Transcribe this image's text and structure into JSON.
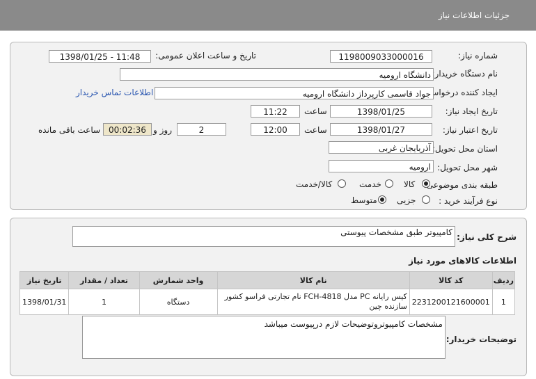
{
  "header": {
    "title": "جزئیات اطلاعات نیاز"
  },
  "form": {
    "need_number_label": "شماره نیاز:",
    "need_number": "1198009033000016",
    "announce_label": "تاریخ و ساعت اعلان عمومی:",
    "announce_value": "1398/01/25 - 11:48",
    "buyer_org_label": "نام دستگاه خریدار:",
    "buyer_org": "دانشگاه ارومیه",
    "creator_label": "ایجاد کننده درخواست:",
    "creator": "جواد قاسمی کارپرداز دانشگاه ارومیه",
    "contact_link": "اطلاعات تماس خریدار",
    "created_date_label": "تاریخ ایجاد نیاز:",
    "created_date": "1398/01/25",
    "time_label": "ساعت",
    "created_time": "11:22",
    "validity_label": "تاریخ اعتبار نیاز:",
    "validity_date": "1398/01/27",
    "validity_time": "12:00",
    "days_value": "2",
    "days_label": "روز و",
    "remaining_time": "00:02:36",
    "remaining_label": "ساعت باقی مانده",
    "province_label": "استان محل تحویل:",
    "province": "آذربایجان غربی",
    "city_label": "شهر محل تحویل:",
    "city": "ارومیه",
    "category_label": "طبقه بندی موضوعی:",
    "category_options": [
      "کالا",
      "خدمت",
      "کالا/خدمت"
    ],
    "category_selected": 0,
    "process_label": "نوع فرآیند خرید :",
    "process_options": [
      "جزیی",
      "متوسط"
    ],
    "process_selected": 1
  },
  "summary": {
    "label": "شرح کلی نیاز:",
    "value": "کامپیوتر طبق مشخصات پیوستی"
  },
  "items": {
    "title": "اطلاعات کالاهای مورد نیاز",
    "columns": [
      "ردیف",
      "کد کالا",
      "نام کالا",
      "واحد شمارش",
      "تعداد / مقدار",
      "تاریخ نیاز"
    ],
    "rows": [
      {
        "row": "1",
        "code": "2231200121600001",
        "name": "کیس رایانه PC مدل FCH-4818 نام تجارتی فراسو کشور سازنده چین",
        "unit": "دستگاه",
        "qty": "1",
        "date": "1398/01/31"
      }
    ]
  },
  "buyer_notes": {
    "label": "توضیحات خریدار:",
    "value": "مشخصات کامپیوتروتوضیحات لازم درپیوست میباشد"
  }
}
